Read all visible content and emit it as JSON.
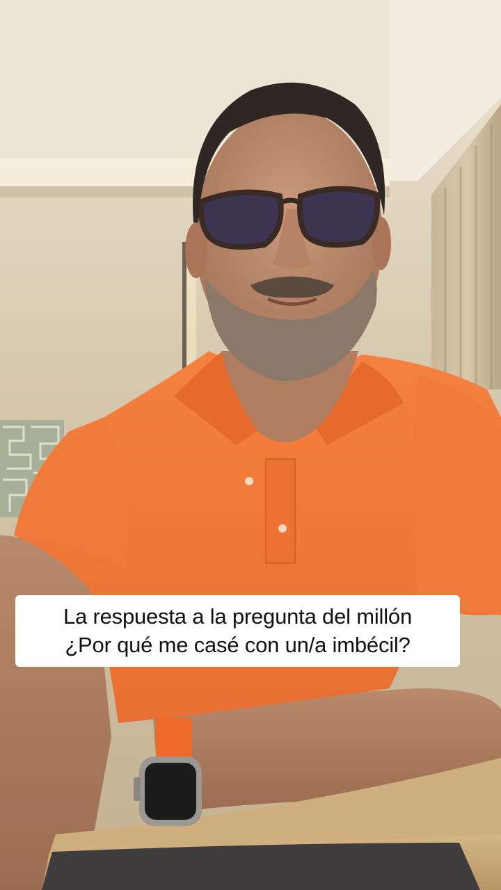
{
  "scene": {
    "description_icon": "video-frame",
    "colors": {
      "wall": "#d2c4aa",
      "ceiling": "#e9e0cf",
      "shirt": "#f07b3c",
      "skin": "#b88a6e",
      "beard": "#8b7a6b",
      "hair": "#2f2723",
      "curtain": "#bfae90",
      "table": "#c9a77c",
      "watch_band": "#ef6a2a"
    }
  },
  "caption": {
    "line1": "La respuesta a la pregunta del millón",
    "line2": "¿Por qué me casé con un/a imbécil?"
  }
}
